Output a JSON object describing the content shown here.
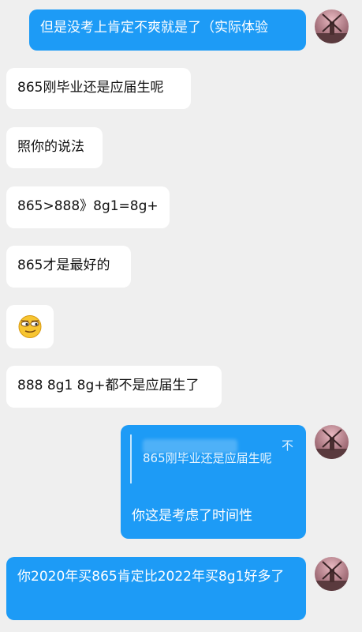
{
  "messages": {
    "m1": "但是没考上肯定不爽就是了（实际体验",
    "m2": "865刚毕业还是应届生呢",
    "m3": "照你的说法",
    "m4": "865>888》8g1=8g+",
    "m5": "865才是最好的",
    "m6": "888 8g1 8g+都不是应届生了",
    "m7_quote_mark": "不",
    "m7_quote": "865刚毕业还是应届生呢",
    "m7_reply": "你这是考虑了时间性",
    "m8": "你2020年买865肯定比2022年买8g1好多了"
  },
  "emoji": "smirk-face",
  "colors": {
    "background": "#efefef",
    "outgoing_bubble": "#1d9bf6",
    "incoming_bubble": "#ffffff"
  }
}
